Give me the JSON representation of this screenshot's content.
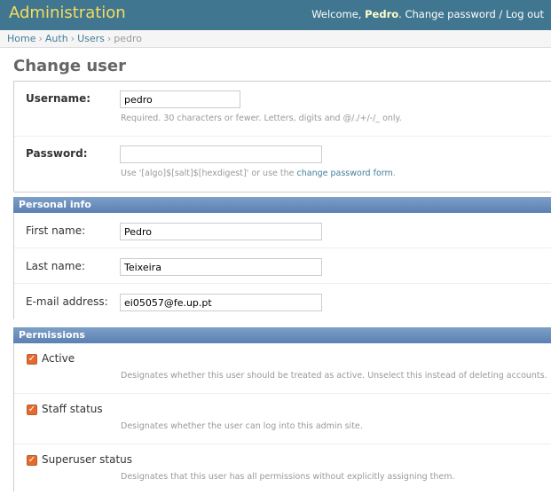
{
  "header": {
    "brand": "Administration",
    "welcome": "Welcome, ",
    "username": "Pedro",
    "change_password": "Change password",
    "separator": " / ",
    "logout": "Log out"
  },
  "breadcrumbs": {
    "home": "Home",
    "auth": "Auth",
    "users": "Users",
    "current": "pedro",
    "sep": "›"
  },
  "page_title": "Change user",
  "account": {
    "username_label": "Username:",
    "username_value": "pedro",
    "username_help": "Required. 30 characters or fewer. Letters, digits and @/./+/-/_ only.",
    "password_label": "Password:",
    "password_value": "",
    "password_help_prefix": "Use '[algo]$[salt]$[hexdigest]' or use the ",
    "password_help_link": "change password form",
    "password_help_suffix": "."
  },
  "personal_info": {
    "heading": "Personal info",
    "first_name_label": "First name:",
    "first_name_value": "Pedro",
    "last_name_label": "Last name:",
    "last_name_value": "Teixeira",
    "email_label": "E-mail address:",
    "email_value": "ei05057@fe.up.pt"
  },
  "permissions": {
    "heading": "Permissions",
    "active_label": "Active",
    "active_help": "Designates whether this user should be treated as active. Unselect this instead of deleting accounts.",
    "staff_label": "Staff status",
    "staff_help": "Designates whether the user can log into this admin site.",
    "superuser_label": "Superuser status",
    "superuser_help": "Designates that this user has all permissions without explicitly assigning them."
  },
  "colors": {
    "header_bg": "#417690",
    "brand": "#f5dd5d",
    "section_head": "#5b80b2",
    "checkbox": "#e8692c"
  },
  "icons": {
    "checkbox_checked": "checkbox-checked-icon"
  }
}
